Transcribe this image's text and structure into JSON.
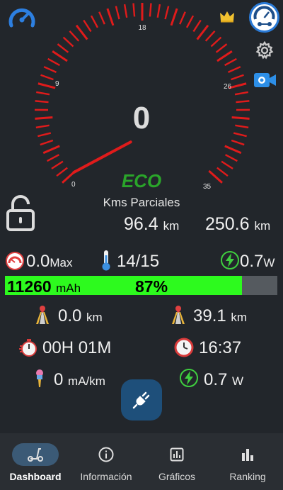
{
  "header": {
    "speedometer_icon": "speedometer-icon",
    "crown_icon": "crown-icon",
    "avatar_icon": "scooter-gauge-avatar-icon",
    "settings_icon": "gear-icon",
    "camera_icon": "video-camera-icon"
  },
  "gauge": {
    "tick_labels": [
      "0",
      "9",
      "18",
      "26",
      "35"
    ],
    "speed": "0",
    "mode": "ECO",
    "partial_label": "Kms Parciales",
    "accent_color": "#e01b1b",
    "needle_value": 0
  },
  "lock_icon": "padlock-open-icon",
  "distances": {
    "partial": "96.4",
    "partial_unit": "km",
    "total": "250.6",
    "total_unit": "km"
  },
  "stats_row": {
    "max_speed": "0.0",
    "max_label": "Max",
    "temperature": "14/15",
    "power": "0.7",
    "power_unit": "W"
  },
  "battery": {
    "capacity": "11260",
    "capacity_unit": "mAh",
    "percent_label": "87%",
    "level": 0.87,
    "fill_color": "#2dfa1e"
  },
  "trip": {
    "distance_a": "0.0",
    "distance_a_unit": "km",
    "distance_b": "39.1",
    "distance_b_unit": "km",
    "timer": "00H 01M",
    "clock": "16:37",
    "consumption": "0",
    "consumption_unit": "mA/km",
    "power": "0.7",
    "power_unit": "W"
  },
  "fab": {
    "icon": "plug-connect-icon"
  },
  "nav": {
    "items": [
      {
        "label": "Dashboard",
        "icon": "scooter-icon",
        "active": true
      },
      {
        "label": "Información",
        "icon": "info-icon",
        "active": false
      },
      {
        "label": "Gráficos",
        "icon": "bar-chart-icon",
        "active": false
      },
      {
        "label": "Ranking",
        "icon": "ranking-icon",
        "active": false
      }
    ]
  }
}
